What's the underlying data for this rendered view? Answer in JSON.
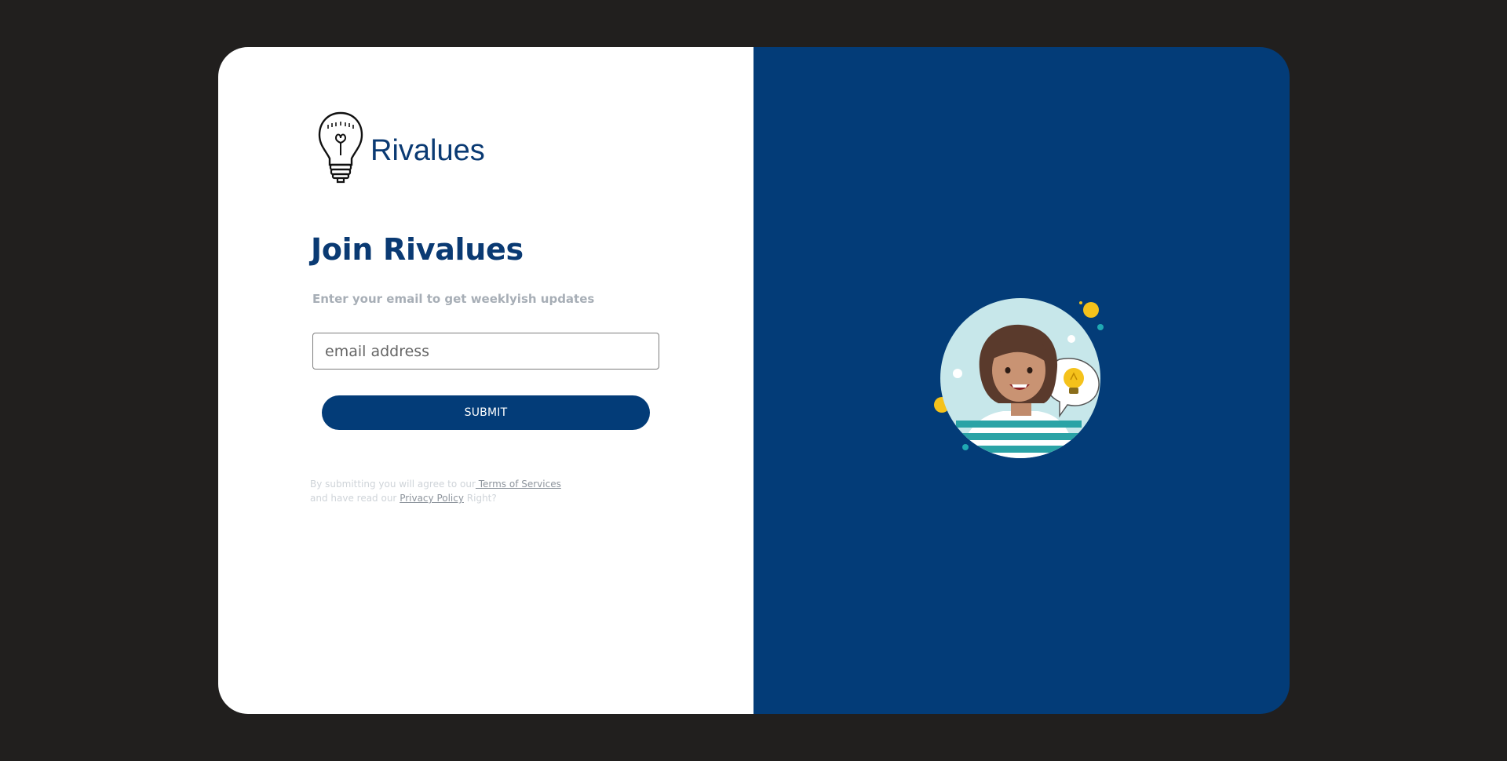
{
  "brand": {
    "name": "Rivalues",
    "icon": "lightbulb-icon",
    "color": "#0a3a73"
  },
  "form": {
    "title": "Join Rivalues",
    "subtitle": "Enter your email to get weeklyish updates",
    "email_placeholder": "email address",
    "email_value": "",
    "submit_label": "SUBMIT"
  },
  "legal": {
    "prefix": "By submitting you will agree to our",
    "terms_label": " Terms of Services",
    "middle": " and have read our ",
    "privacy_label": "Privacy Policy",
    "suffix": " Right?"
  },
  "illustration": {
    "icon": "woman-with-idea-icon"
  },
  "colors": {
    "background": "#211f1e",
    "accent": "#033c78",
    "panel": "#ffffff"
  }
}
